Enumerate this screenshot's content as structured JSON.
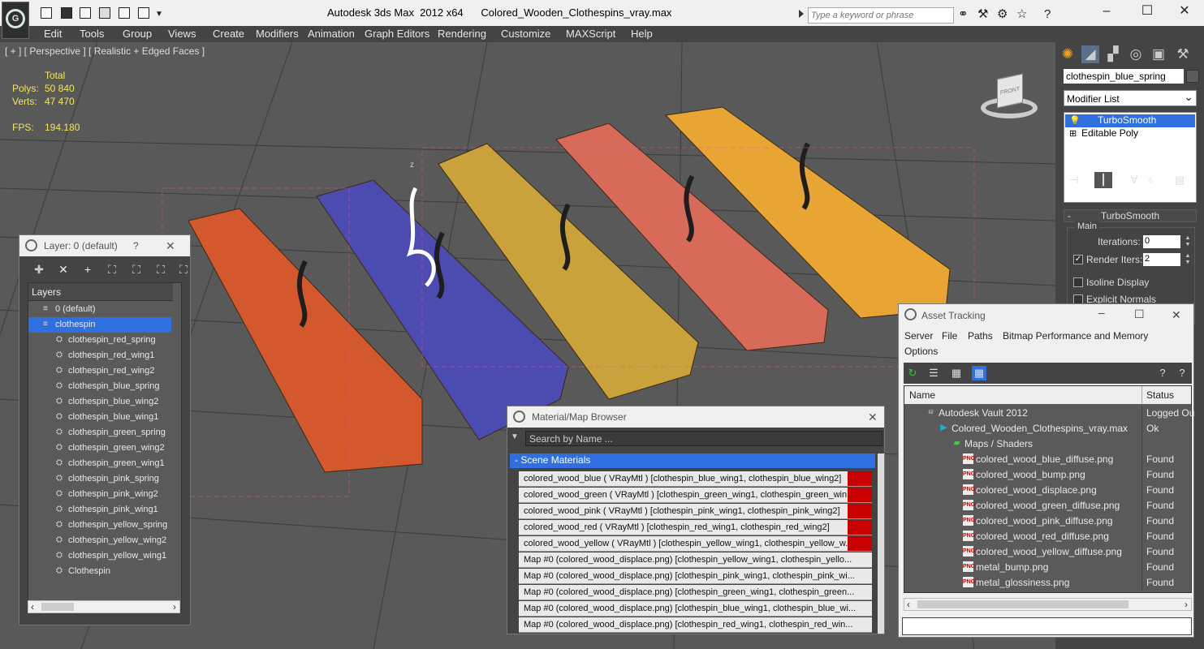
{
  "window": {
    "app_title": "Autodesk 3ds Max  2012 x64",
    "file_title": "Colored_Wooden_Clothespins_vray.max",
    "search_placeholder": "Type a keyword or phrase"
  },
  "menu": [
    "Edit",
    "Tools",
    "Group",
    "Views",
    "Create",
    "Modifiers",
    "Animation",
    "Graph Editors",
    "Rendering",
    "Customize",
    "MAXScript",
    "Help"
  ],
  "viewport": {
    "label": "[ + ] [ Perspective ] [ Realistic + Edged Faces ]",
    "total_label": "Total",
    "polys_label": "Polys:",
    "polys_value": "50 840",
    "verts_label": "Verts:",
    "verts_value": "47 470",
    "fps_label": "FPS:",
    "fps_value": "194.180",
    "viewcube_label": "FRONT",
    "axis_label": "z",
    "clothespin_colors": [
      "#d4582e",
      "#4b4bb0",
      "#c9a23c",
      "#d86a5a",
      "#e8a534"
    ]
  },
  "command_panel": {
    "object_name": "clothespin_blue_spring",
    "modifier_list": "Modifier List",
    "stack": [
      {
        "label": "TurboSmooth",
        "selected": true,
        "icon": "lightbulb-icon"
      },
      {
        "label": "Editable Poly",
        "selected": false,
        "icon": "plus-icon"
      }
    ],
    "rollout_title": "TurboSmooth",
    "group_label": "Main",
    "iterations_label": "Iterations:",
    "iterations_value": "0",
    "render_iters_label": "Render Iters:",
    "render_iters_value": "2",
    "render_iters_checked": "✓",
    "isoline_label": "Isoline Display",
    "explicit_label": "Explicit Normals"
  },
  "layer_dialog": {
    "title": "Layer: 0 (default)",
    "help": "?",
    "close": "✕",
    "header": "Layers",
    "rows": [
      {
        "label": "0 (default)",
        "type": "layer"
      },
      {
        "label": "clothespin",
        "type": "layer"
      },
      {
        "label": "clothespin_red_spring",
        "type": "object"
      },
      {
        "label": "clothespin_red_wing1",
        "type": "object"
      },
      {
        "label": "clothespin_red_wing2",
        "type": "object"
      },
      {
        "label": "clothespin_blue_spring",
        "type": "object"
      },
      {
        "label": "clothespin_blue_wing2",
        "type": "object"
      },
      {
        "label": "clothespin_blue_wing1",
        "type": "object"
      },
      {
        "label": "clothespin_green_spring",
        "type": "object"
      },
      {
        "label": "clothespin_green_wing2",
        "type": "object"
      },
      {
        "label": "clothespin_green_wing1",
        "type": "object"
      },
      {
        "label": "clothespin_pink_spring",
        "type": "object"
      },
      {
        "label": "clothespin_pink_wing2",
        "type": "object"
      },
      {
        "label": "clothespin_pink_wing1",
        "type": "object"
      },
      {
        "label": "clothespin_yellow_spring",
        "type": "object"
      },
      {
        "label": "clothespin_yellow_wing2",
        "type": "object"
      },
      {
        "label": "clothespin_yellow_wing1",
        "type": "object"
      },
      {
        "label": "Clothespin",
        "type": "object"
      }
    ]
  },
  "material_browser": {
    "title": "Material/Map Browser",
    "close": "✕",
    "search_placeholder": "Search by Name ...",
    "group_label": "- Scene Materials",
    "rows": [
      "colored_wood_blue ( VRayMtl ) [clothespin_blue_wing1, clothespin_blue_wing2]",
      "colored_wood_green ( VRayMtl ) [clothespin_green_wing1, clothespin_green_win...",
      "colored_wood_pink ( VRayMtl ) [clothespin_pink_wing1, clothespin_pink_wing2]",
      "colored_wood_red ( VRayMtl ) [clothespin_red_wing1, clothespin_red_wing2]",
      "colored_wood_yellow ( VRayMtl ) [clothespin_yellow_wing1, clothespin_yellow_w...",
      "Map #0 (colored_wood_displace.png) [clothespin_yellow_wing1, clothespin_yello...",
      "Map #0 (colored_wood_displace.png) [clothespin_pink_wing1, clothespin_pink_wi...",
      "Map #0 (colored_wood_displace.png) [clothespin_green_wing1, clothespin_green...",
      "Map #0 (colored_wood_displace.png) [clothespin_blue_wing1, clothespin_blue_wi...",
      "Map #0 (colored_wood_displace.png) [clothespin_red_wing1, clothespin_red_win..."
    ]
  },
  "asset_tracking": {
    "title": "Asset Tracking",
    "menu": [
      "Server",
      "File",
      "Paths",
      "Bitmap Performance and Memory",
      "Options"
    ],
    "col_name": "Name",
    "col_status": "Status",
    "rows": [
      {
        "name": "Autodesk Vault 2012",
        "status": "Logged Ou",
        "level": 1,
        "icon": "vault-icon"
      },
      {
        "name": "Colored_Wooden_Clothespins_vray.max",
        "status": "Ok",
        "level": 2,
        "icon": "max-file-icon"
      },
      {
        "name": "Maps / Shaders",
        "status": "",
        "level": 3,
        "icon": "maps-folder-icon"
      },
      {
        "name": "colored_wood_blue_diffuse.png",
        "status": "Found",
        "level": 4,
        "icon": "png-icon"
      },
      {
        "name": "colored_wood_bump.png",
        "status": "Found",
        "level": 4,
        "icon": "png-icon"
      },
      {
        "name": "colored_wood_displace.png",
        "status": "Found",
        "level": 4,
        "icon": "png-icon"
      },
      {
        "name": "colored_wood_green_diffuse.png",
        "status": "Found",
        "level": 4,
        "icon": "png-icon"
      },
      {
        "name": "colored_wood_pink_diffuse.png",
        "status": "Found",
        "level": 4,
        "icon": "png-icon"
      },
      {
        "name": "colored_wood_red_diffuse.png",
        "status": "Found",
        "level": 4,
        "icon": "png-icon"
      },
      {
        "name": "colored_wood_yellow_diffuse.png",
        "status": "Found",
        "level": 4,
        "icon": "png-icon"
      },
      {
        "name": "metal_bump.png",
        "status": "Found",
        "level": 4,
        "icon": "png-icon"
      },
      {
        "name": "metal_glossiness.png",
        "status": "Found",
        "level": 4,
        "icon": "png-icon"
      }
    ]
  }
}
